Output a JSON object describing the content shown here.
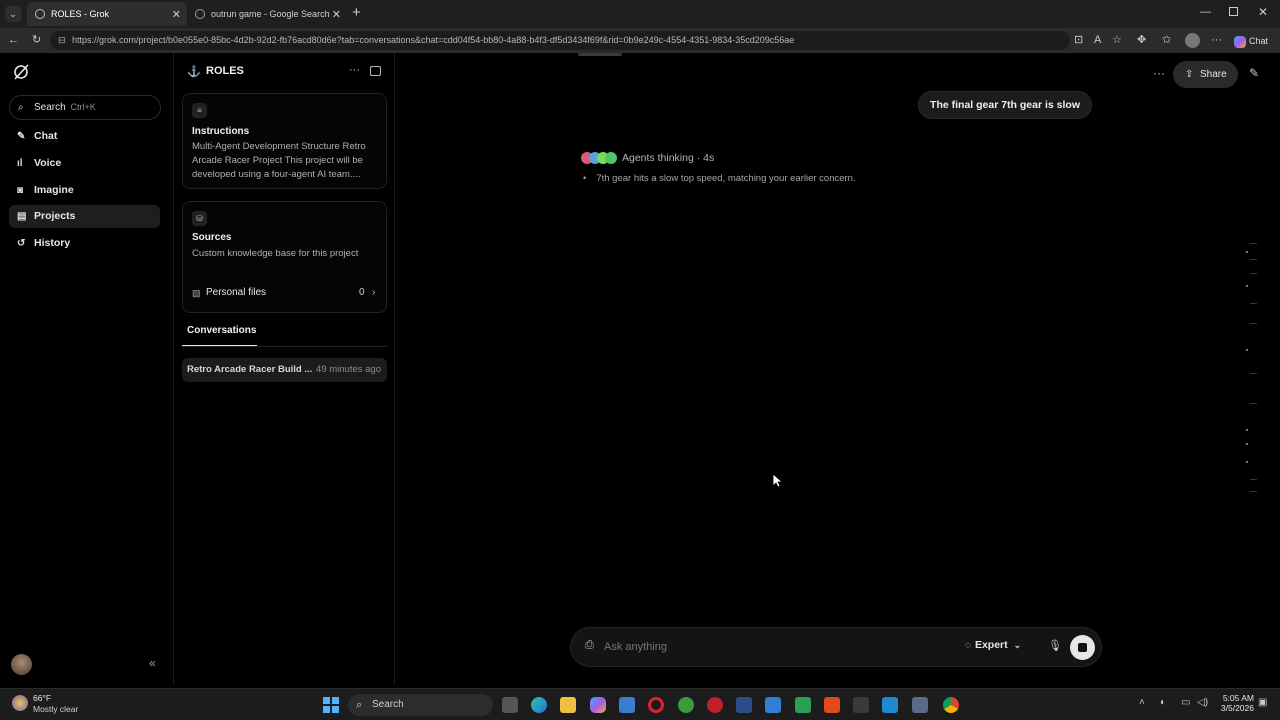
{
  "browser": {
    "tabs": [
      {
        "title": "ROLES - Grok",
        "active": true
      },
      {
        "title": "outrun game - Google Search",
        "active": false
      }
    ],
    "url": "https://grok.com/project/b0e055e0-85bc-4d2b-92d2-fb76acd80d6e?tab=conversations&chat=cdd04f54-bb80-4a88-b4f3-df5d3434f69f&rid=0b9e249c-4554-4351-9834-35cd209c56ae",
    "chat_button": "Chat"
  },
  "sidebar": {
    "search_label": "Search",
    "search_shortcut": "Ctrl+K",
    "items": [
      {
        "label": "Chat",
        "icon": "chat-icon"
      },
      {
        "label": "Voice",
        "icon": "voice-icon"
      },
      {
        "label": "Imagine",
        "icon": "imagine-icon"
      },
      {
        "label": "Projects",
        "icon": "projects-icon",
        "selected": true
      },
      {
        "label": "History",
        "icon": "history-icon"
      }
    ]
  },
  "project": {
    "title": "ROLES",
    "instructions_title": "Instructions",
    "instructions_text": "Multi-Agent Development Structure Retro Arcade Racer Project This project will be developed using a four-agent AI team....",
    "sources_title": "Sources",
    "sources_text": "Custom knowledge base for this project",
    "personal_files_label": "Personal files",
    "personal_files_count": "0",
    "conversations_tab": "Conversations",
    "conversations": [
      {
        "title": "Retro Arcade Racer Build ...",
        "time": "49 minutes ago"
      }
    ]
  },
  "chat": {
    "share_label": "Share",
    "user_message": "The final gear 7th gear is slow",
    "agents_status": "Agents thinking · 4s",
    "thinking_bullets": [
      "7th gear hits a slow top speed, matching your earlier concern."
    ],
    "composer_placeholder": "Ask anything",
    "mode_label": "Expert"
  },
  "taskbar": {
    "weather_temp": "66°F",
    "weather_desc": "Mostly clear",
    "search_label": "Search",
    "time": "5:05 AM",
    "date": "3/5/2026"
  }
}
